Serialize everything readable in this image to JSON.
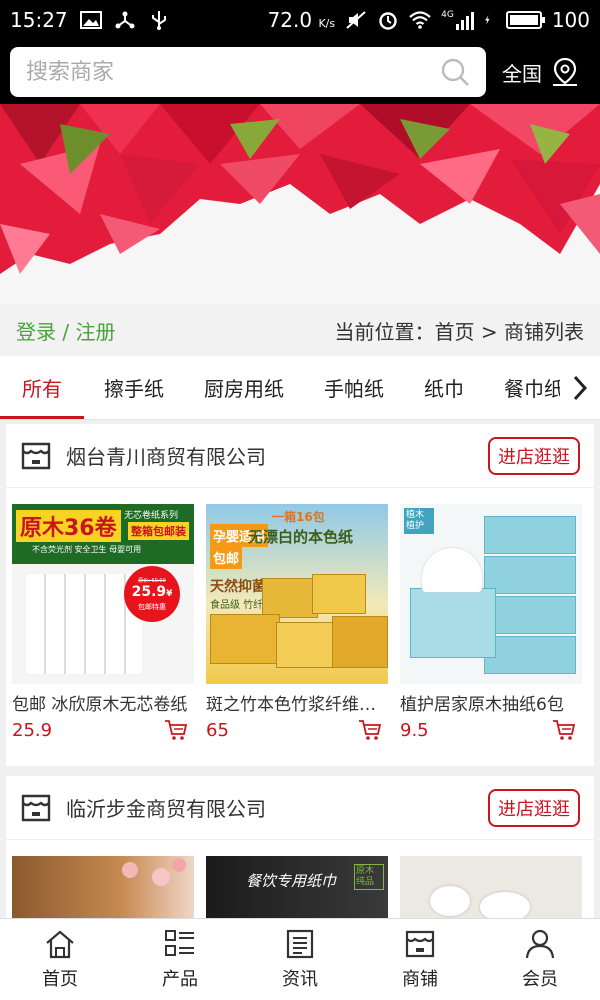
{
  "status": {
    "time": "15:27",
    "speed": "72.0",
    "speed_unit": "K/s",
    "net": "4G",
    "battery": "100"
  },
  "header": {
    "search_placeholder": "搜索商家",
    "region": "全国"
  },
  "breadcrumb": {
    "login": "登录 / 注册",
    "location": "当前位置：首页 > 商铺列表"
  },
  "tabs": [
    "所有",
    "擦手纸",
    "厨房用纸",
    "手帕纸",
    "纸巾",
    "餐巾纸"
  ],
  "shops": [
    {
      "name": "烟台青川商贸有限公司",
      "enter_label": "进店逛逛",
      "products": [
        {
          "name": "包邮 冰欣原木无芯卷纸",
          "price": "25.9",
          "img_title": "原木36卷",
          "img_sub": "整箱包邮装",
          "img_tag": "无芯卷纸系列",
          "img_badge": "25.9",
          "img_badge_unit": "¥",
          "img_badge_note": "包邮特惠",
          "img_strike": "原价: 60.00",
          "img_features": "不含荧光剂 安全卫生 母婴可用"
        },
        {
          "name": "斑之竹本色竹浆纤维抽纸",
          "price": "65",
          "img_title": "一箱16包",
          "img_title2": "无漂白的本色纸",
          "img_tag": "孕婴适用",
          "img_tag2": "包邮",
          "img_sub": "天然抑菌",
          "img_sub2": "食品级 竹纤维"
        },
        {
          "name": "植护居家原木抽纸6包",
          "price": "9.5",
          "img_tag": "植木植护"
        }
      ]
    },
    {
      "name": "临沂步金商贸有限公司",
      "enter_label": "进店逛逛",
      "products": [
        {
          "name": "",
          "price": ""
        },
        {
          "name": "",
          "price": "",
          "img_title": "餐饮专用纸巾",
          "img_tag": "原木纯品"
        },
        {
          "name": "",
          "price": ""
        }
      ]
    }
  ],
  "bottom_nav": [
    {
      "label": "首页",
      "icon": "home-icon"
    },
    {
      "label": "产品",
      "icon": "grid-list-icon"
    },
    {
      "label": "资讯",
      "icon": "news-icon"
    },
    {
      "label": "商铺",
      "icon": "shop-icon"
    },
    {
      "label": "会员",
      "icon": "user-icon"
    }
  ],
  "colors": {
    "accent": "#c9151e",
    "login_green": "#4aa33a"
  }
}
